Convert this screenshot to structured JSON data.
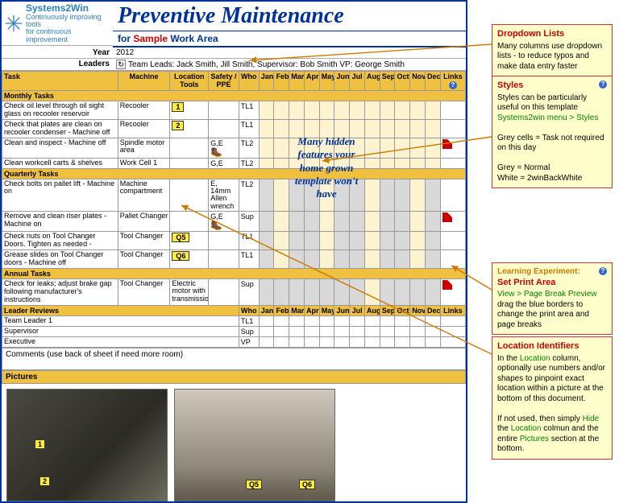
{
  "logo": {
    "brand": "Systems2Win",
    "tagline1": "Continuously improving tools",
    "tagline2": "for continuous improvement"
  },
  "title": "Preventive Maintenance",
  "for_prefix": "for ",
  "for_sample": "Sample",
  "for_suffix": " Work Area",
  "year_label": "Year",
  "year_value": "2012",
  "leaders_label": "Leaders",
  "leaders_value": "Team Leads: Jack Smith, Jill Smith, Supervisor: Bob Smith  VP: George Smith",
  "columns": {
    "task": "Task",
    "machine": "Machine",
    "location": "Location Tools",
    "safety": "Safety / PPE",
    "who": "Who",
    "months": [
      "Jan",
      "Feb",
      "Mar",
      "Apr",
      "May",
      "Jun",
      "Jul",
      "Aug",
      "Sep",
      "Oct",
      "Nov",
      "Dec"
    ],
    "links": "Links"
  },
  "sections": {
    "monthly": "Monthly Tasks",
    "quarterly": "Quarterly Tasks",
    "annual": "Annual Tasks",
    "leader": "Leader Reviews"
  },
  "rows": {
    "monthly": [
      {
        "task": "Check oil level through oil sight glass on recooler reservoir",
        "machine": "Recooler",
        "loc_tag": "1",
        "who": "TL1"
      },
      {
        "task": "Check that plates are clean on recooler condenser - Machine off",
        "machine": "Recooler",
        "loc_tag": "2",
        "who": "TL1"
      },
      {
        "task": "Clean and  inspect - Machine off",
        "machine": "Spindle motor area",
        "safety": "G,E",
        "safety_icon": true,
        "who": "TL2",
        "pdf": true
      },
      {
        "task": "Clean workcell carts & shelves",
        "machine": "Work Cell 1",
        "safety": "G,E",
        "who": "TL2"
      }
    ],
    "quarterly": [
      {
        "task": "Check bolts on pallet lift - Machine on",
        "machine": "Machine compartment",
        "safety": "E, 14mm Allen wrench",
        "who": "TL2",
        "grey_first": true
      },
      {
        "task": "Remove and clean riser plates - Machine on",
        "machine": "Pallet Changer",
        "safety": "G,E",
        "safety_icon": true,
        "who": "Sup",
        "grey_first": true,
        "pdf": true
      },
      {
        "task": "Check nuts on Tool Changer Doors. Tighten as needed -",
        "machine": "Tool Changer",
        "loc_tag": "Q5",
        "who": "TL1",
        "grey_first": true
      },
      {
        "task": "Grease slides on Tool Changer doors - Machine off",
        "machine": "Tool Changer",
        "loc_tag": "Q6",
        "who": "TL1",
        "grey_first": true
      }
    ],
    "annual": [
      {
        "task": "Check for leaks; adjust brake gap following manufacturer's instructions",
        "machine": "Tool Changer",
        "loc": "Electric motor with transmission",
        "who": "Sup",
        "grey_first": true,
        "pdf": true
      }
    ],
    "leader": [
      {
        "task": "Team Leader 1",
        "who": "TL1"
      },
      {
        "task": "Supervisor",
        "who": "Sup"
      },
      {
        "task": "Executive",
        "who": "VP"
      }
    ]
  },
  "who_col_label": "Who",
  "comments_label": "Comments (use back of sheet if need more room)",
  "pictures_label": "Pictures",
  "markers": {
    "p1a": "1",
    "p1b": "2",
    "p2a": "Q5",
    "p2b": "Q6"
  },
  "burst_lines": [
    "Many hidden",
    "features your",
    "home grown",
    "template won't",
    "have"
  ],
  "notes": {
    "dropdown": {
      "title": "Dropdown Lists",
      "body": "Many columns use dropdown lists - to reduce typos and make data entry faster"
    },
    "styles": {
      "title": "Styles",
      "l1": "Styles can be particularly useful on this template",
      "l2": "Systems2win menu > Styles",
      "l3": "Grey cells = Task not required on this day",
      "l4": "Grey = Normal",
      "l5": "White = 2winBackWhite"
    },
    "print": {
      "title1": "Learning Experiment:",
      "title2": "Set Print Area",
      "l1": "View > Page Break Preview",
      "l2": "drag the blue borders to change the print area and page breaks"
    },
    "location": {
      "title": "Location Identifiers",
      "l1a": "In the ",
      "l1b": "Location",
      "l1c": " column,",
      "l2": "optionally use numbers and/or shapes to pinpoint exact location within a picture at the bottom of this document.",
      "l3a": "If not used, then simply ",
      "l3b": "Hide",
      "l3c": " the ",
      "l3d": "Location",
      "l3e": " colmun and the entire ",
      "l3f": "Pictures",
      "l3g": " section at the bottom."
    }
  }
}
